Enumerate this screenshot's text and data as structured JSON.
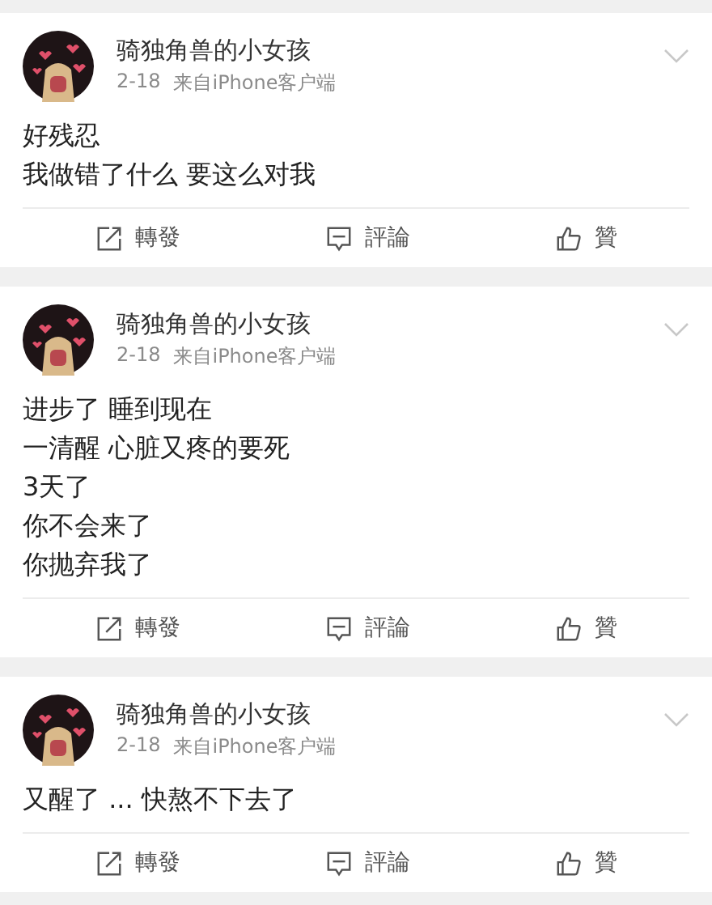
{
  "posts": [
    {
      "author": "骑独角兽的小女孩",
      "date": "2-18",
      "source": "来自iPhone客户端",
      "lines": [
        "好残忍",
        "我做错了什么 要这么对我"
      ],
      "actions": [
        {
          "kind": "repost",
          "label": "轉發"
        },
        {
          "kind": "comment",
          "label": "評論"
        },
        {
          "kind": "like",
          "label": "贊"
        }
      ]
    },
    {
      "author": "骑独角兽的小女孩",
      "date": "2-18",
      "source": "来自iPhone客户端",
      "lines": [
        "进步了 睡到现在",
        "一清醒 心脏又疼的要死",
        "3天了",
        "你不会来了",
        "你抛弃我了"
      ],
      "actions": [
        {
          "kind": "repost",
          "label": "轉發"
        },
        {
          "kind": "comment",
          "label": "評論"
        },
        {
          "kind": "like",
          "label": "贊"
        }
      ]
    },
    {
      "author": "骑独角兽的小女孩",
      "date": "2-18",
      "source": "来自iPhone客户端",
      "lines": [
        "又醒了 ... 快熬不下去了"
      ],
      "actions": [
        {
          "kind": "repost",
          "label": "轉發"
        },
        {
          "kind": "comment",
          "label": "評論"
        },
        {
          "kind": "like",
          "label": "贊"
        }
      ]
    }
  ]
}
